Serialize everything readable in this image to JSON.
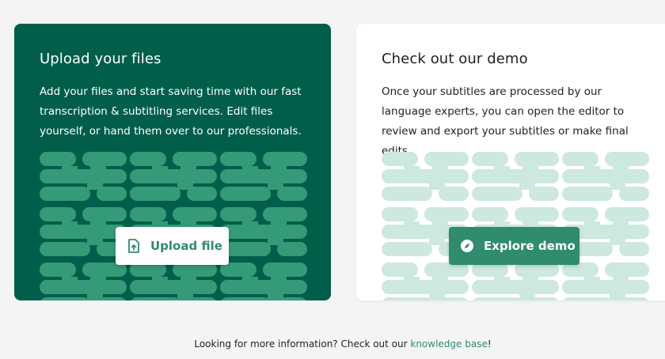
{
  "upload_card": {
    "title": "Upload your files",
    "text": "Add your files and start saving time with our fast transcription & subtitling services. Edit files yourself, or hand them over to our professionals.",
    "button_label": "Upload file",
    "button_icon": "upload-file-icon",
    "background": "#015e4b",
    "pattern_color": "#349a78"
  },
  "demo_card": {
    "title": "Check out our demo",
    "text": "Once your subtitles are processed by our language experts, you can open the editor to review and export your subtitles or make final edits.",
    "button_label": "Explore demo",
    "button_icon": "compass-icon",
    "background": "#ffffff",
    "pattern_color": "#cde8df"
  },
  "footer": {
    "text_before": "Looking for more information? Check out our ",
    "link_label": "knowledge base",
    "text_after": "!"
  },
  "colors": {
    "accent": "#2f8c6e",
    "page_background": "#f4f4f4"
  }
}
